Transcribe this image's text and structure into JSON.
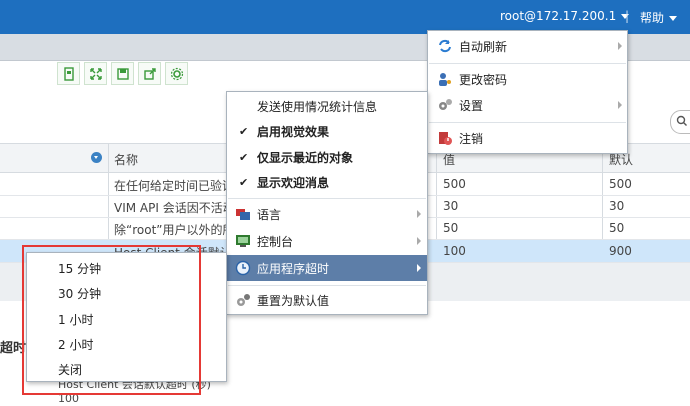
{
  "topbar": {
    "user_label": "root@172.17.200.1",
    "help_label": "帮助"
  },
  "toolbar": {
    "icons": [
      "page-icon",
      "expand-icon",
      "save-icon",
      "export-icon",
      "gear-icon"
    ]
  },
  "grid": {
    "headers": {
      "name": "名称",
      "value": "值",
      "default": "默认"
    },
    "rows": [
      {
        "name": "在任何给定时间已验证",
        "value": "500",
        "default": "500"
      },
      {
        "name": "VIM API 会话因不活动",
        "value": "30",
        "default": "30"
      },
      {
        "name": "除“root”用户以外的所有",
        "value": "50",
        "default": "50"
      },
      {
        "name": "Host Client 会话默认超",
        "value": "100",
        "default": "900"
      }
    ]
  },
  "detail": {
    "title": "超时",
    "sub": "Host Client 会话默认超时 (秒)",
    "value": "100"
  },
  "user_menu": {
    "items": [
      {
        "label": "自动刷新",
        "icon": "refresh-icon"
      },
      {
        "label": "更改密码",
        "icon": "user-key-icon"
      },
      {
        "label": "设置",
        "icon": "settings-gears-icon"
      },
      {
        "label": "注销",
        "icon": "logout-icon"
      }
    ]
  },
  "settings_menu": {
    "items": [
      {
        "label": "发送使用情况统计信息"
      },
      {
        "label": "启用视觉效果"
      },
      {
        "label": "仅显示最近的对象"
      },
      {
        "label": "显示欢迎消息"
      },
      {
        "label": "语言"
      },
      {
        "label": "控制台"
      },
      {
        "label": "应用程序超时"
      },
      {
        "label": "重置为默认值"
      }
    ]
  },
  "timeout_menu": {
    "items": [
      {
        "label": "15 分钟"
      },
      {
        "label": "30 分钟"
      },
      {
        "label": "1 小时"
      },
      {
        "label": "2 小时"
      },
      {
        "label": "关闭"
      }
    ]
  },
  "colors": {
    "topbar": "#1e6fbf",
    "highlight": "#5d7ea8",
    "selection": "#cfe6fa",
    "annotation": "#e53935"
  }
}
